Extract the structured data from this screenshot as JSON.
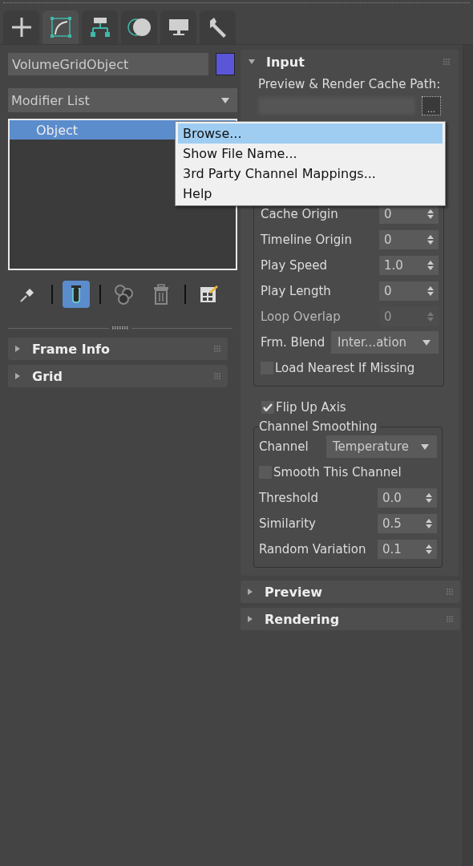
{
  "tabs": [
    {
      "kind": "plus",
      "selected": false
    },
    {
      "kind": "modify",
      "selected": true
    },
    {
      "kind": "hierarchy",
      "selected": false
    },
    {
      "kind": "motion",
      "selected": false
    },
    {
      "kind": "display",
      "selected": false
    },
    {
      "kind": "utilities",
      "selected": false
    }
  ],
  "object_name": {
    "value": "VolumeGridObject",
    "color": "#5b55d8"
  },
  "modifier_list": {
    "value": "Modifier List"
  },
  "stack": [
    {
      "label": "Object",
      "selected": true
    }
  ],
  "stack_tools": [
    {
      "kind": "pin",
      "active": false
    },
    {
      "kind": "separator"
    },
    {
      "kind": "tube",
      "active": true
    },
    {
      "kind": "separator"
    },
    {
      "kind": "unique",
      "active": false
    },
    {
      "kind": "trash",
      "active": false
    },
    {
      "kind": "separator"
    },
    {
      "kind": "configure",
      "active": false
    }
  ],
  "left_rollouts": [
    {
      "title": "Frame Info",
      "expanded": false
    },
    {
      "title": "Grid",
      "expanded": false
    }
  ],
  "input_rollout": {
    "title": "Input",
    "expanded": true,
    "path_label": "Preview & Render Cache Path:",
    "browse_button": "...",
    "rows": [
      {
        "kind": "spinner",
        "label": "Cache Origin",
        "value": "0",
        "disabled": false
      },
      {
        "kind": "spinner",
        "label": "Timeline Origin",
        "value": "0",
        "disabled": false
      },
      {
        "kind": "spinner",
        "label": "Play Speed",
        "value": "1.0",
        "disabled": false
      },
      {
        "kind": "spinner",
        "label": "Play Length",
        "value": "0",
        "disabled": false
      },
      {
        "kind": "spinner",
        "label": "Loop Overlap",
        "value": "0",
        "disabled": true
      },
      {
        "kind": "dropdown",
        "label": "Frm. Blend",
        "value": "Inter...ation",
        "disabled": false
      },
      {
        "kind": "checkbox",
        "label": "Load Nearest If Missing",
        "checked": false
      }
    ]
  },
  "flip_up_axis": {
    "label": "Flip Up Axis",
    "checked": true
  },
  "channel_smoothing": {
    "title": "Channel Smoothing",
    "rows": [
      {
        "kind": "dropdown",
        "label": "Channel",
        "value": "Temperature",
        "disabled": false
      },
      {
        "kind": "checkbox",
        "label": "Smooth This Channel",
        "checked": false
      },
      {
        "kind": "spinner",
        "label": "Threshold",
        "value": "0.0",
        "disabled": false
      },
      {
        "kind": "spinner",
        "label": "Similarity",
        "value": "0.5",
        "disabled": false
      },
      {
        "kind": "spinner",
        "label": "Random Variation",
        "value": "0.1",
        "disabled": false
      }
    ]
  },
  "right_rollouts": [
    {
      "title": "Preview",
      "expanded": false
    },
    {
      "title": "Rendering",
      "expanded": false
    }
  ],
  "context_menu": [
    {
      "label": "Browse...",
      "selected": true
    },
    {
      "label": "Show File Name...",
      "selected": false
    },
    {
      "label": "3rd Party Channel Mappings...",
      "selected": false
    },
    {
      "label": "Help",
      "selected": false
    }
  ]
}
